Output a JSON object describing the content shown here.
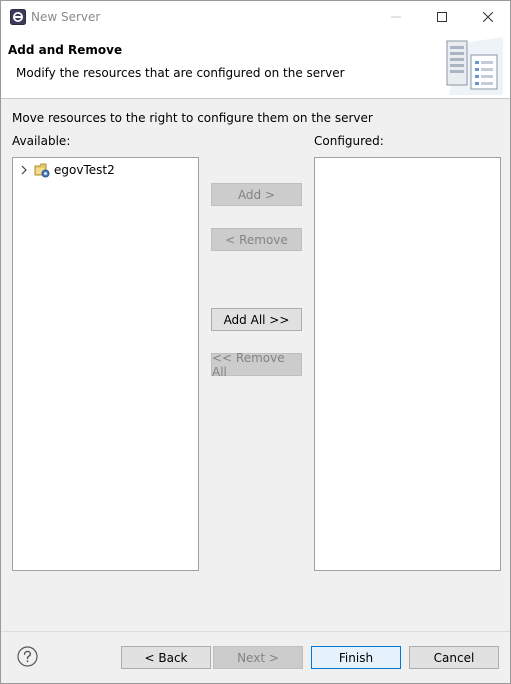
{
  "window": {
    "title": "New Server"
  },
  "header": {
    "title": "Add and Remove",
    "description": "Modify the resources that are configured on the server"
  },
  "main": {
    "instruction": "Move resources to the right to configure them on the server",
    "available_label": "Available:",
    "configured_label": "Configured:",
    "available_items": [
      {
        "label": "egovTest2",
        "icon": "project-icon",
        "expanded": false
      }
    ],
    "configured_items": []
  },
  "buttons": {
    "add": "Add >",
    "remove": "< Remove",
    "add_all": "Add All >>",
    "remove_all": "<< Remove All"
  },
  "footer": {
    "back": "< Back",
    "next": "Next >",
    "finish": "Finish",
    "cancel": "Cancel"
  },
  "colors": {
    "accent": "#0078d7",
    "disabled_text": "#838383"
  }
}
